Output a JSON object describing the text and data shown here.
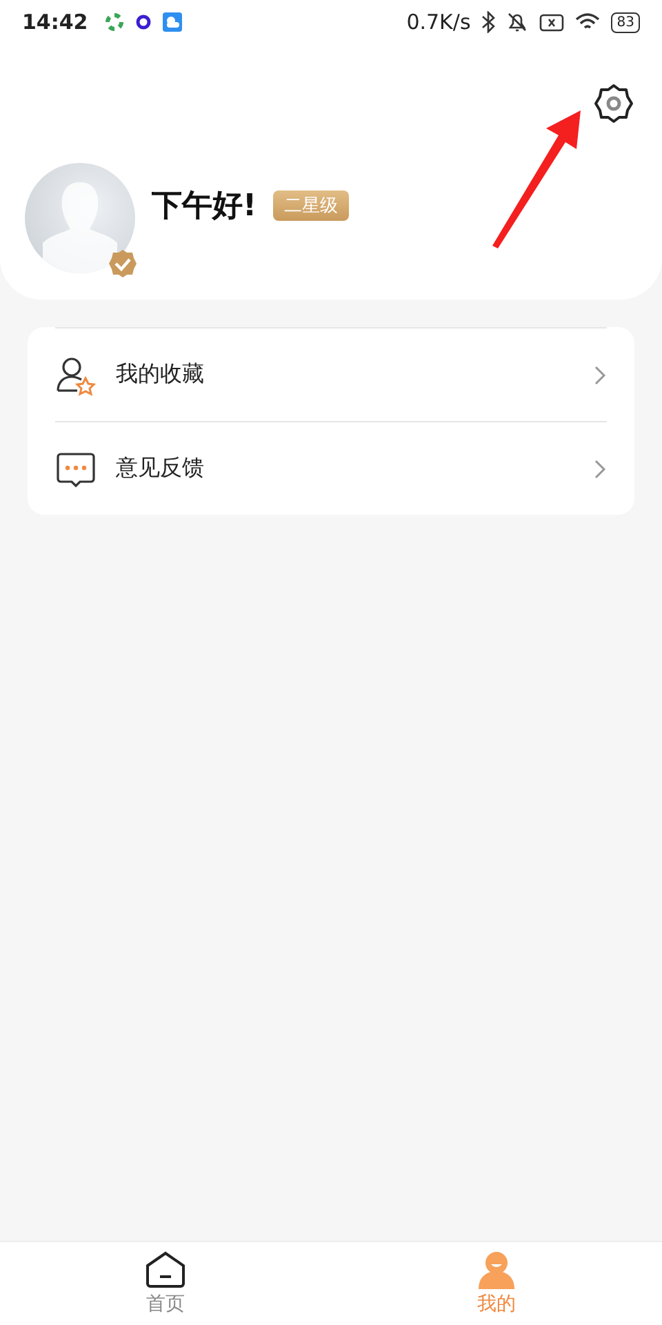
{
  "status_bar": {
    "time": "14:42",
    "speed": "0.7K/s",
    "battery": "83"
  },
  "header": {
    "greeting": "下午好!",
    "level_badge": "二星级"
  },
  "menu": [
    {
      "label": "我的收藏",
      "kind": "favorites"
    },
    {
      "label": "意见反馈",
      "kind": "feedback"
    }
  ],
  "tabs": [
    {
      "label": "首页",
      "selected": false,
      "kind": "home"
    },
    {
      "label": "我的",
      "selected": true,
      "kind": "profile"
    }
  ]
}
